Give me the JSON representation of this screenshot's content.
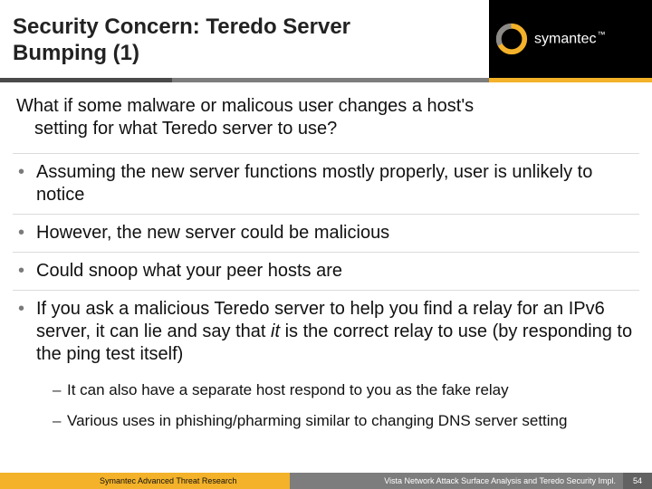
{
  "brand": {
    "name": "symantec",
    "tm": "™",
    "accent_yellow": "#f3b229",
    "accent_gray": "#7d7d7d",
    "accent_dark": "#4a4a4a"
  },
  "header": {
    "title_line1": "Security Concern: Teredo Server",
    "title_line2": "Bumping (1)"
  },
  "lead": {
    "line1": "What if some malware or malicous user changes a host's",
    "line2": "setting for what Teredo server to use?"
  },
  "bullets": [
    {
      "text": "Assuming the new server functions mostly properly, user is unlikely to notice"
    },
    {
      "text": "However, the new server could be malicious"
    },
    {
      "text": "Could snoop what your peer hosts are"
    },
    {
      "text_pre": "If you ask a malicious Teredo server to help you find a relay for an IPv6 server, it can lie and say that ",
      "text_it": "it",
      "text_post": " is the correct relay to use (by responding to the ping test itself)",
      "sub": [
        "It can also have a separate host respond to you as the fake relay",
        "Various uses in phishing/pharming similar to changing DNS server setting"
      ]
    }
  ],
  "footer": {
    "left": "Symantec Advanced Threat Research",
    "center": "Vista Network Attack Surface Analysis and Teredo Security Impl.",
    "page": "54"
  }
}
